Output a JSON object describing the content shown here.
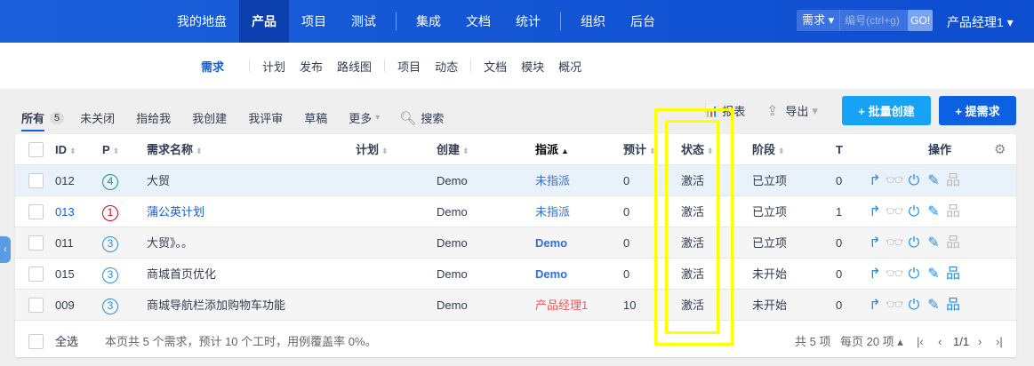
{
  "topnav": {
    "items": [
      "我的地盘",
      "产品",
      "项目",
      "测试",
      "集成",
      "文档",
      "统计",
      "组织",
      "后台"
    ],
    "active": "产品",
    "search_type": "需求",
    "search_placeholder": "编号(ctrl+g)",
    "go": "GO!",
    "user": "产品经理1"
  },
  "subnav": {
    "items": [
      "需求",
      "计划",
      "发布",
      "路线图",
      "项目",
      "动态",
      "文档",
      "模块",
      "概况"
    ],
    "active": "需求"
  },
  "filters": {
    "items": [
      "所有",
      "未关闭",
      "指给我",
      "我创建",
      "我评审",
      "草稿",
      "更多"
    ],
    "all_count": "5",
    "search": "搜索"
  },
  "toolbar": {
    "report": "报表",
    "export": "导出",
    "batch_create": "+ 批量创建",
    "create": "+ 提需求"
  },
  "colors": {
    "primary": "#0c60e1",
    "batch": "#17a3f5",
    "highlight": "#ffff00"
  },
  "table": {
    "headers": {
      "id": "ID",
      "p": "P",
      "name": "需求名称",
      "plan": "计划",
      "creator": "创建",
      "assign": "指派",
      "estimate": "预计",
      "status": "状态",
      "stage": "阶段",
      "t": "T",
      "actions": "操作"
    },
    "rows": [
      {
        "id": "012",
        "p": "4",
        "name": "大贸",
        "plan": "",
        "creator": "Demo",
        "assign": "未指派",
        "estimate": "0",
        "status": "激活",
        "stage": "已立项",
        "t": "0"
      },
      {
        "id": "013",
        "p": "1",
        "name": "蒲公英计划",
        "plan": "",
        "creator": "Demo",
        "assign": "未指派",
        "estimate": "0",
        "status": "激活",
        "stage": "已立项",
        "t": "1"
      },
      {
        "id": "011",
        "p": "3",
        "name": "大贸》。。",
        "plan": "",
        "creator": "Demo",
        "assign": "Demo",
        "estimate": "0",
        "status": "激活",
        "stage": "已立项",
        "t": "0"
      },
      {
        "id": "015",
        "p": "3",
        "name": "商城首页优化",
        "plan": "",
        "creator": "Demo",
        "assign": "Demo",
        "estimate": "0",
        "status": "激活",
        "stage": "未开始",
        "t": "0"
      },
      {
        "id": "009",
        "p": "3",
        "name": "商城导航栏添加购物车功能",
        "plan": "",
        "creator": "Demo",
        "assign": "产品经理1",
        "estimate": "10",
        "status": "激活",
        "stage": "未开始",
        "t": "0"
      }
    ]
  },
  "footer": {
    "select_all": "全选",
    "summary": "本页共 5 个需求，预计 10 个工时，用例覆盖率 0%。",
    "total": "共 5 项",
    "per_page": "每页 20 项",
    "page": "1/1"
  }
}
